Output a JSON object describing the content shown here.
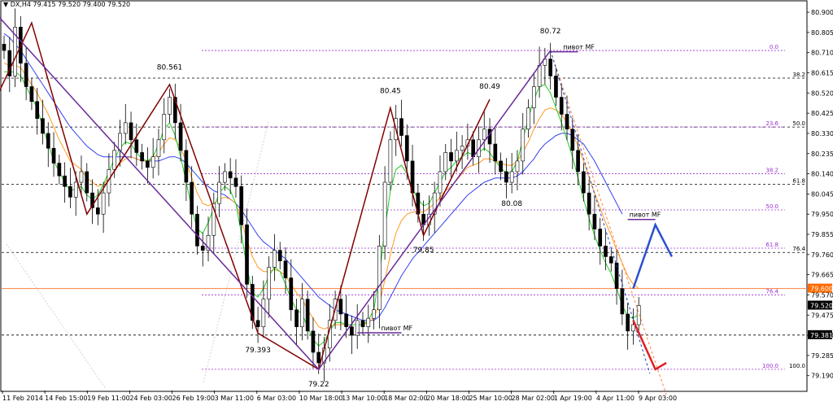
{
  "header": {
    "arrow_glyph": "▼",
    "symbol": "DX,H4",
    "ohlc": "79.415 79.520 79.400 79.520"
  },
  "chart_data": {
    "type": "candlestick",
    "ylim": [
      79.12,
      80.95
    ],
    "y_ticks": [
      "80.900",
      "80.805",
      "80.710",
      "80.615",
      "80.520",
      "80.425",
      "80.330",
      "80.235",
      "80.140",
      "80.045",
      "79.950",
      "79.855",
      "79.760",
      "79.665",
      "79.570",
      "79.475",
      "79.380",
      "79.285",
      "79.190"
    ],
    "x_ticks": [
      "11 Feb 2014",
      "14 Feb 15:00",
      "19 Feb 11:00",
      "24 Feb 03:00",
      "26 Feb 19:00",
      "3 Mar 11:00",
      "6 Mar 03:00",
      "10 Mar 18:00",
      "13 Mar 10:00",
      "18 Mar 02:00",
      "20 Mar 18:00",
      "25 Mar 10:00",
      "28 Mar 02:00",
      "1 Apr 19:00",
      "4 Apr 11:00",
      "9 Apr 03:00"
    ],
    "price_tags": [
      {
        "value": 79.6,
        "text": "79.600",
        "color": "#ff6a00"
      },
      {
        "value": 79.52,
        "text": "79.520",
        "color": "#000000"
      },
      {
        "value": 79.381,
        "text": "79.381",
        "color": "#000000"
      }
    ],
    "swing_labels": [
      {
        "text": "80.561",
        "index": 30,
        "value": 80.63
      },
      {
        "text": "79.393",
        "index": 46,
        "value": 79.3
      },
      {
        "text": "79.22",
        "index": 57,
        "value": 79.14
      },
      {
        "text": "80.45",
        "index": 70,
        "value": 80.52
      },
      {
        "text": "79.85",
        "index": 76,
        "value": 79.77
      },
      {
        "text": "80.49",
        "index": 88,
        "value": 80.54
      },
      {
        "text": "80.08",
        "index": 92,
        "value": 79.99
      },
      {
        "text": "80.72",
        "index": 99,
        "value": 80.8
      }
    ],
    "pivot_labels": [
      {
        "text": "пивот MF",
        "index": 101,
        "value": 80.714
      },
      {
        "text": "пивот MF",
        "index": 113,
        "value": 79.925
      },
      {
        "text": "пивот MF",
        "index": 68,
        "value": 79.392
      }
    ],
    "fib_left": [
      {
        "text": "0.0",
        "value": 80.72
      },
      {
        "text": "23.6",
        "value": 80.36
      },
      {
        "text": "38.2",
        "value": 80.14
      },
      {
        "text": "50.0",
        "value": 79.97
      },
      {
        "text": "61.8",
        "value": 79.79
      },
      {
        "text": "76.4",
        "value": 79.57
      },
      {
        "text": "100.0",
        "value": 79.22
      }
    ],
    "fib_right": [
      {
        "text": "38.2",
        "value": 80.59
      },
      {
        "text": "50.0",
        "value": 80.36
      },
      {
        "text": "61.8",
        "value": 80.09
      },
      {
        "text": "76.4",
        "value": 79.77
      },
      {
        "text": "100.0",
        "value": 79.22
      }
    ],
    "closes": [
      80.72,
      80.6,
      80.83,
      80.66,
      80.55,
      80.48,
      80.4,
      80.33,
      80.26,
      80.19,
      80.13,
      80.08,
      80.03,
      80.1,
      80.15,
      80.05,
      79.98,
      79.95,
      80.05,
      80.16,
      80.25,
      80.33,
      80.38,
      80.3,
      80.24,
      80.2,
      80.17,
      80.22,
      80.3,
      80.42,
      80.5,
      80.38,
      80.25,
      80.1,
      79.95,
      79.8,
      79.78,
      79.85,
      80.0,
      80.1,
      80.15,
      80.12,
      80.08,
      79.9,
      79.62,
      79.45,
      79.42,
      79.55,
      79.7,
      79.78,
      79.73,
      79.65,
      79.5,
      79.42,
      79.55,
      79.4,
      79.3,
      79.25,
      79.32,
      79.45,
      79.55,
      79.48,
      79.42,
      79.38,
      79.45,
      79.42,
      79.46,
      79.5,
      79.8,
      80.1,
      80.3,
      80.4,
      80.32,
      80.2,
      80.05,
      79.95,
      79.9,
      79.95,
      80.05,
      80.15,
      80.24,
      80.2,
      80.25,
      80.27,
      80.3,
      80.22,
      80.3,
      80.35,
      80.28,
      80.2,
      80.15,
      80.1,
      80.15,
      80.2,
      80.35,
      80.45,
      80.55,
      80.65,
      80.68,
      80.6,
      80.5,
      80.42,
      80.35,
      80.25,
      80.15,
      80.05,
      79.95,
      79.88,
      79.8,
      79.75,
      79.72,
      79.6,
      79.48,
      79.4,
      79.43,
      79.52
    ],
    "ma_fast": [
      80.62,
      80.62,
      80.62,
      80.6,
      80.55,
      80.5,
      80.45,
      80.36,
      80.28,
      80.2,
      80.15,
      80.1,
      80.06,
      80.07,
      80.08,
      80.04,
      80.02,
      80.04,
      80.09,
      80.15,
      80.21,
      80.26,
      80.29,
      80.28,
      80.24,
      80.21,
      80.2,
      80.22,
      80.28,
      80.35,
      80.38,
      80.32,
      80.22,
      80.1,
      79.98,
      79.88,
      79.86,
      79.91,
      79.98,
      80.05,
      80.08,
      80.06,
      80.0,
      79.86,
      79.7,
      79.58,
      79.56,
      79.6,
      79.66,
      79.7,
      79.68,
      79.62,
      79.55,
      79.5,
      79.48,
      79.42,
      79.36,
      79.33,
      79.35,
      79.4,
      79.44,
      79.44,
      79.43,
      79.43,
      79.43,
      79.43,
      79.45,
      79.5,
      79.66,
      79.88,
      80.06,
      80.16,
      80.18,
      80.14,
      80.07,
      80.02,
      79.99,
      80.0,
      80.05,
      80.1,
      80.15,
      80.17,
      80.2,
      80.22,
      80.24,
      80.23,
      80.24,
      80.26,
      80.24,
      80.2,
      80.17,
      80.14,
      80.15,
      80.2,
      80.3,
      80.4,
      80.49,
      80.55,
      80.56,
      80.52,
      80.45,
      80.38,
      80.3,
      80.22,
      80.12,
      80.02,
      79.93,
      79.85,
      79.78,
      79.72,
      79.67,
      79.6,
      79.52,
      79.47,
      79.46,
      79.48
    ],
    "ma_mid": [
      80.66,
      80.65,
      80.65,
      80.64,
      80.6,
      80.56,
      80.52,
      80.47,
      80.42,
      80.36,
      80.3,
      80.25,
      80.2,
      80.18,
      80.16,
      80.12,
      80.1,
      80.08,
      80.09,
      80.12,
      80.15,
      80.19,
      80.21,
      80.22,
      80.21,
      80.2,
      80.2,
      80.21,
      80.24,
      80.28,
      80.31,
      80.3,
      80.26,
      80.2,
      80.12,
      80.05,
      80.0,
      79.99,
      80.0,
      80.02,
      80.03,
      80.02,
      80.0,
      79.92,
      79.83,
      79.75,
      79.7,
      79.68,
      79.68,
      79.69,
      79.68,
      79.66,
      79.62,
      79.58,
      79.55,
      79.5,
      79.46,
      79.42,
      79.41,
      79.42,
      79.43,
      79.43,
      79.43,
      79.43,
      79.43,
      79.43,
      79.44,
      79.46,
      79.53,
      79.64,
      79.76,
      79.86,
      79.92,
      79.95,
      79.96,
      79.96,
      79.96,
      79.98,
      80.0,
      80.03,
      80.06,
      80.08,
      80.11,
      80.14,
      80.17,
      80.18,
      80.19,
      80.21,
      80.21,
      80.2,
      80.19,
      80.18,
      80.18,
      80.2,
      80.24,
      80.29,
      80.35,
      80.4,
      80.44,
      80.45,
      80.44,
      80.42,
      80.38,
      80.33,
      80.27,
      80.2,
      80.12,
      80.05,
      79.98,
      79.91,
      79.85,
      79.78,
      79.72,
      79.66,
      79.62,
      79.6
    ],
    "ma_slow": [
      80.8,
      80.78,
      80.75,
      80.72,
      80.68,
      80.64,
      80.6,
      80.56,
      80.52,
      80.48,
      80.44,
      80.4,
      80.36,
      80.33,
      80.3,
      80.27,
      80.25,
      80.23,
      80.22,
      80.22,
      80.22,
      80.22,
      80.22,
      80.22,
      80.21,
      80.2,
      80.2,
      80.2,
      80.2,
      80.21,
      80.22,
      80.22,
      80.21,
      80.19,
      80.16,
      80.13,
      80.1,
      80.08,
      80.06,
      80.05,
      80.04,
      80.02,
      80.0,
      79.97,
      79.93,
      79.89,
      79.85,
      79.82,
      79.8,
      79.78,
      79.76,
      79.74,
      79.71,
      79.68,
      79.65,
      79.62,
      79.59,
      79.56,
      79.54,
      79.52,
      79.5,
      79.49,
      79.48,
      79.47,
      79.46,
      79.45,
      79.45,
      79.45,
      79.47,
      79.51,
      79.56,
      79.61,
      79.66,
      79.7,
      79.74,
      79.77,
      79.8,
      79.83,
      79.86,
      79.89,
      79.92,
      79.95,
      79.98,
      80.01,
      80.04,
      80.06,
      80.08,
      80.1,
      80.11,
      80.12,
      80.12,
      80.12,
      80.12,
      80.13,
      80.15,
      80.18,
      80.21,
      80.25,
      80.28,
      80.3,
      80.32,
      80.33,
      80.33,
      80.32,
      80.3,
      80.28,
      80.24,
      80.2,
      80.15,
      80.1,
      80.05,
      80.0,
      79.95
    ],
    "zigzag_maroon": [
      [
        -1,
        80.52
      ],
      [
        5,
        80.85
      ],
      [
        15,
        79.95
      ],
      [
        30,
        80.56
      ],
      [
        46,
        79.39
      ],
      [
        57,
        79.22
      ],
      [
        70,
        80.45
      ],
      [
        76,
        79.85
      ],
      [
        88,
        80.49
      ]
    ],
    "zigzag_purple": [
      [
        -1,
        80.88
      ],
      [
        57,
        79.22
      ],
      [
        99,
        80.72
      ]
    ],
    "trend_orange_dotted": [
      [
        99,
        80.72
      ],
      [
        120,
        79.1
      ]
    ],
    "trend_blue_dotted": [
      [
        99,
        80.72
      ],
      [
        117,
        79.2
      ]
    ],
    "arrow_blue": [
      [
        114,
        79.6
      ],
      [
        118,
        79.9
      ],
      [
        121,
        79.75
      ]
    ],
    "arrow_red": [
      [
        114,
        79.45
      ],
      [
        118,
        79.22
      ],
      [
        120,
        79.25
      ]
    ]
  }
}
